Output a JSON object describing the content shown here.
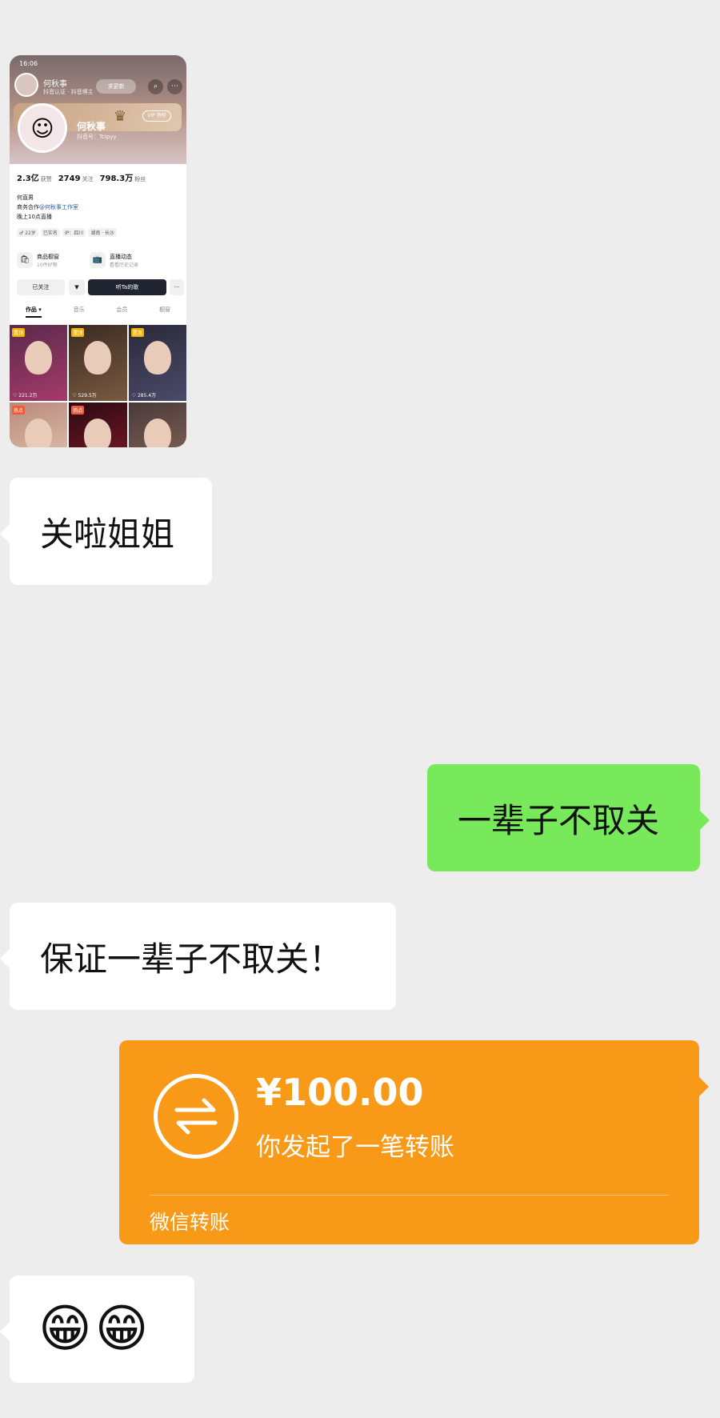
{
  "screenshot": {
    "status_time": "16:06",
    "header_name": "何秋事",
    "header_sub": "抖音认证 · 抖音博主",
    "follow_btn": "求更新",
    "vip_label": "VIP",
    "vip_button": "VIP 特权",
    "profile_name": "何秋事",
    "profile_id": "抖音号：Tcipyy",
    "stats": [
      {
        "value": "2.3亿",
        "label": "获赞"
      },
      {
        "value": "2749",
        "label": "关注"
      },
      {
        "value": "798.3万",
        "label": "粉丝"
      }
    ],
    "bio_lines": [
      "何直男",
      "商务合作@何秋事工作室",
      "晚上10点直播"
    ],
    "bio_link": "@何秋事工作室",
    "tags": [
      "♂ 22岁",
      "已实名",
      "IP：四川",
      "湖南 · 长沙"
    ],
    "features": [
      {
        "icon": "🛍",
        "title": "商品橱窗",
        "sub": "10件好物"
      },
      {
        "icon": "📺",
        "title": "直播动态",
        "sub": "看看历史记录"
      }
    ],
    "actions": {
      "followed": "已关注",
      "listen": "听Ta的歌",
      "more": "···"
    },
    "tabs": [
      "作品 ▾",
      "音乐",
      "会员",
      "橱窗"
    ],
    "tiles": [
      {
        "badge": "置顶",
        "likes": "♡ 221.2万"
      },
      {
        "badge": "置顶",
        "likes": "♡ 529.5万"
      },
      {
        "badge": "置顶",
        "likes": "♡ 285.4万"
      },
      {
        "badge": "热点",
        "likes": ""
      },
      {
        "badge": "热点",
        "likes": ""
      },
      {
        "badge": "",
        "likes": ""
      }
    ]
  },
  "messages": [
    {
      "side": "left",
      "text": "关啦姐姐"
    },
    {
      "side": "right",
      "text": "一辈子不取关"
    },
    {
      "side": "left",
      "text": "保证一辈子不取关！"
    }
  ],
  "transfer": {
    "amount": "¥100.00",
    "description": "你发起了一笔转账",
    "footer": "微信转账"
  },
  "emoji_message": "😁😁",
  "colors": {
    "background": "#ededed",
    "my_bubble": "#78e95a",
    "other_bubble": "#ffffff",
    "transfer": "#f89a17"
  }
}
